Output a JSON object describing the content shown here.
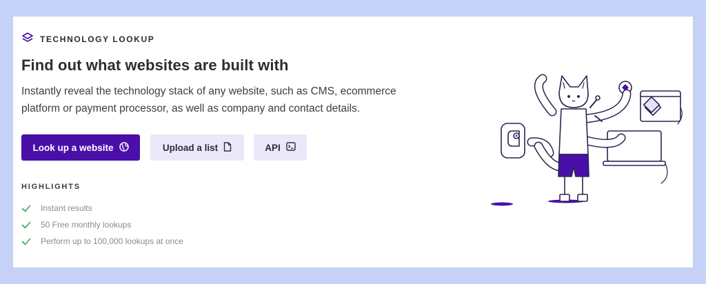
{
  "header": {
    "eyebrow": "TECHNOLOGY LOOKUP",
    "title": "Find out what websites are built with",
    "description": "Instantly reveal the technology stack of any website, such as CMS, ecommerce platform or payment processor, as well as company and contact details."
  },
  "actions": {
    "lookup_label": "Look up a website",
    "upload_label": "Upload a list",
    "api_label": "API"
  },
  "highlights": {
    "heading": "HIGHLIGHTS",
    "items": [
      "Instant results",
      "50 Free monthly lookups",
      "Perform up to 100,000 lookups at once"
    ]
  },
  "icons": {
    "logo": "layers-icon",
    "lookup": "globe-icon",
    "upload": "file-icon",
    "api": "terminal-icon",
    "check": "check-icon"
  },
  "colors": {
    "background": "#c5d1f6",
    "primary": "#4a0fa8",
    "secondary_button": "#ece8f9",
    "check": "#3fa85b"
  }
}
